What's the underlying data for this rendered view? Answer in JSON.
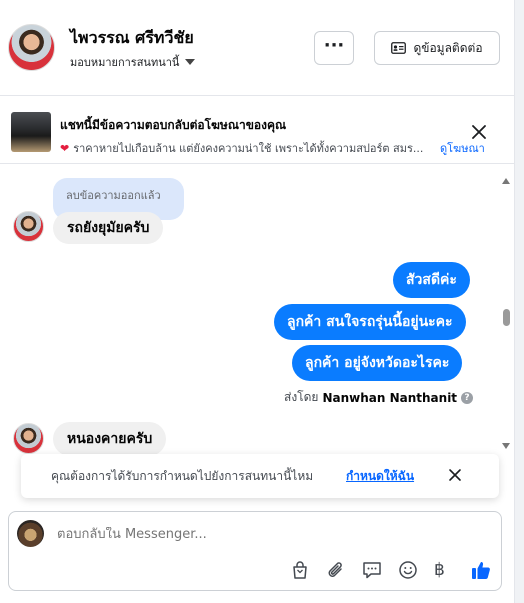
{
  "header": {
    "contact_name": "ไพวรรณ ศรีทวีชัย",
    "assign_label": "มอบหมายการสนทนานี้",
    "more_label": "···",
    "contact_info_label": "ดูข้อมูลติดต่อ"
  },
  "ad_banner": {
    "title": "แชทนี้มีข้อความตอบกลับต่อโฆษณาของคุณ",
    "subtitle": "ราคาหายไปเกือบล้าน แต่ยังคงความน่าใช้ เพราะได้ทั้งความสปอร์ต สมร...",
    "view_ad_label": "ดูโฆษณา"
  },
  "messages": {
    "deleted_text": "ลบข้อความออกแล้ว",
    "incoming_1": "รถยังยุมัยครับ",
    "outgoing_1": "สัวสดีค่ะ",
    "outgoing_2": "ลูกค้า สนใจรถรุ่นนี้อยู่นะคะ",
    "outgoing_3": "ลูกค้า อยู่จังหวัดอะไรคะ",
    "sent_by_prefix": "ส่งโดย",
    "sent_by_name": "Nanwhan Nanthanit",
    "incoming_2": "หนองคายครับ"
  },
  "assign_prompt": {
    "text": "คุณต้องการได้รับการกำหนดไปยังการสนทนานี้ไหม",
    "link": "กำหนดให้ฉัน"
  },
  "composer": {
    "placeholder": "ตอบกลับใน Messenger...",
    "baht_symbol": "฿"
  },
  "colors": {
    "outgoing_bubble": "#0a7cff",
    "incoming_bubble": "#f0f0f0",
    "deleted_bubble": "#dbe7fb",
    "link": "#0866ff",
    "like": "#0866ff"
  },
  "icons": {
    "more": "ellipsis-icon",
    "contact_card": "id-card-icon",
    "close": "close-icon",
    "help": "question-icon",
    "shop": "shopping-bag-icon",
    "attach": "paperclip-icon",
    "saved_reply": "speech-bubble-icon",
    "emoji": "smiley-icon",
    "payment": "baht-icon",
    "like": "thumbs-up-icon"
  }
}
